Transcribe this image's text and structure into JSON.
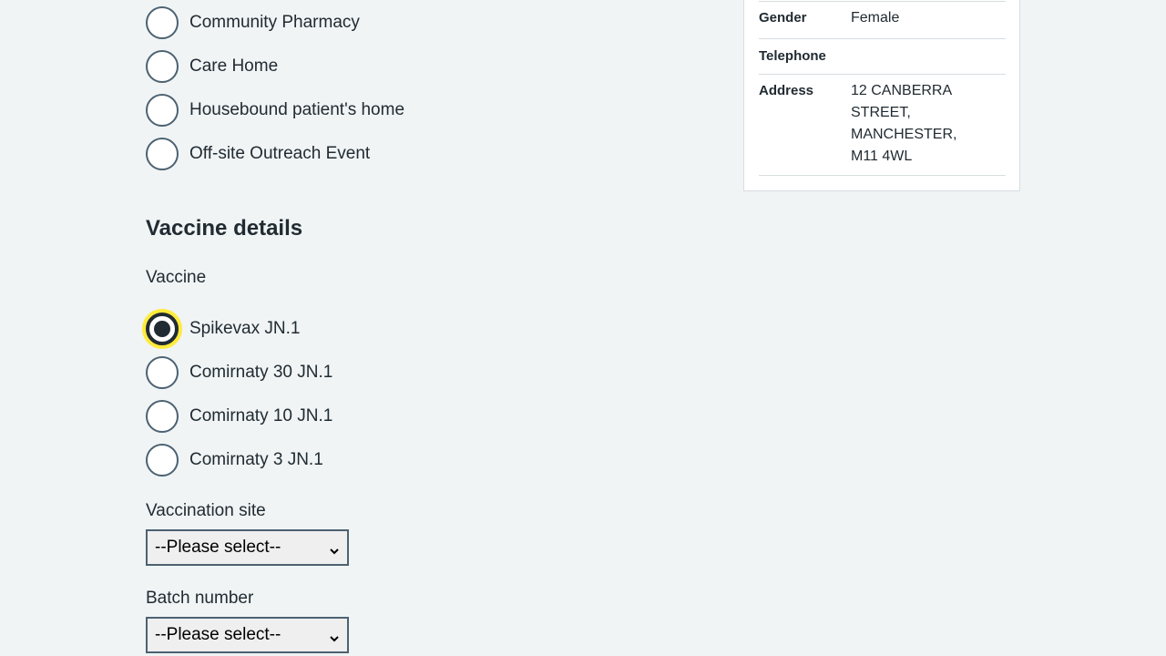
{
  "setting_options": [
    {
      "label": "Community Pharmacy",
      "checked": false
    },
    {
      "label": "Care Home",
      "checked": false
    },
    {
      "label": "Housebound patient's home",
      "checked": false
    },
    {
      "label": "Off-site Outreach Event",
      "checked": false
    }
  ],
  "vaccine_details": {
    "heading": "Vaccine details",
    "vaccine_label": "Vaccine",
    "vaccine_options": [
      {
        "label": "Spikevax JN.1",
        "checked": true
      },
      {
        "label": "Comirnaty 30 JN.1",
        "checked": false
      },
      {
        "label": "Comirnaty 10 JN.1",
        "checked": false
      },
      {
        "label": "Comirnaty 3 JN.1",
        "checked": false
      }
    ],
    "site_label": "Vaccination site",
    "site_select_value": "--Please select--",
    "batch_label": "Batch number",
    "batch_select_value": "--Please select--"
  },
  "patient_panel": {
    "gender_key": "Gender",
    "gender_value": "Female",
    "telephone_key": "Telephone",
    "telephone_value": "",
    "address_key": "Address",
    "address_value": "12 CANBERRA\nSTREET,\nMANCHESTER,\nM11 4WL"
  },
  "colors": {
    "background": "#f0f4f5",
    "text": "#212b32",
    "radio_border": "#4c6272",
    "focus_ring": "#ffeb3b"
  }
}
